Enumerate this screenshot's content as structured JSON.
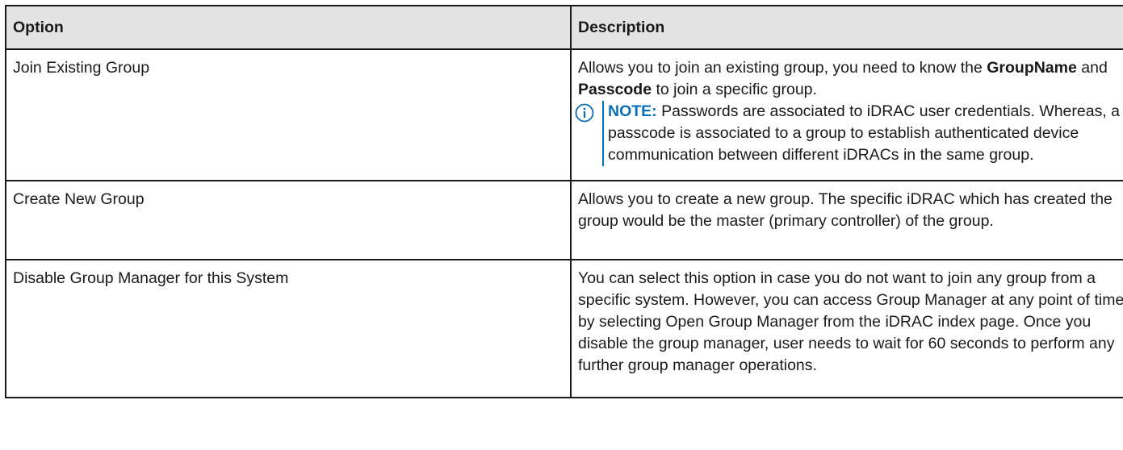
{
  "table": {
    "headers": {
      "option": "Option",
      "description": "Description"
    },
    "rows": [
      {
        "option": "Join Existing Group",
        "desc_part1": "Allows you to join an existing group, you need to know the",
        "desc_bold1": "GroupName",
        "desc_and": "and",
        "desc_bold2": "Passcode",
        "desc_part2": "to join a specific group.",
        "note_label": "NOTE:",
        "note_text": "Passwords are associated to iDRAC user credentials. Whereas, a passcode is associated to a group to establish authenticated device communication between different iDRACs in the same group."
      },
      {
        "option": "Create New Group",
        "description": "Allows you to create a new group. The specific iDRAC which has created the group would be the master (primary controller) of the group."
      },
      {
        "option": "Disable Group Manager for this System",
        "description": "You can select this option in case you do not want to join any group from a specific system. However, you can access Group Manager at any point of time by selecting Open Group Manager from the iDRAC index page. Once you disable the group manager, user needs to wait for 60 seconds to perform any further group manager operations."
      }
    ]
  },
  "icons": {
    "note": "info-circle-icon",
    "accent_color": "#0a6fb8"
  }
}
